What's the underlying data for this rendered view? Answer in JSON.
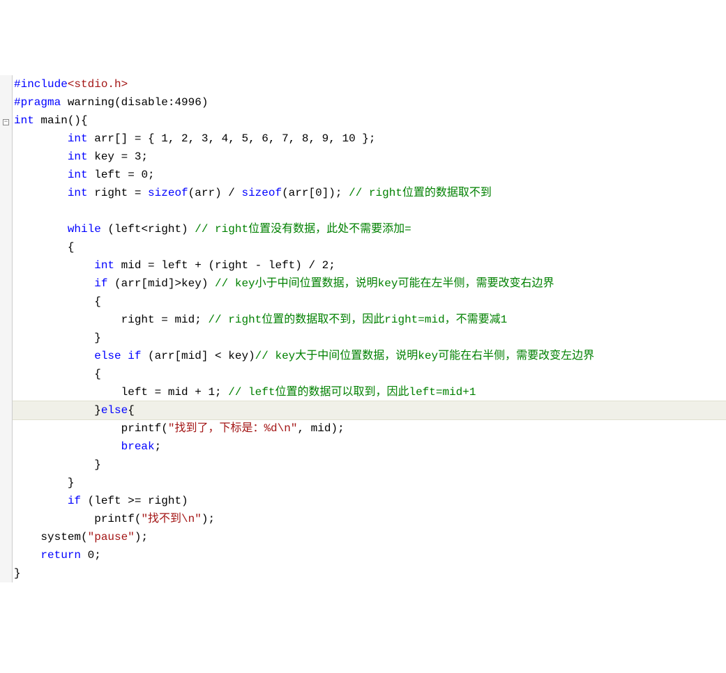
{
  "code": {
    "lines": [
      {
        "fold": "",
        "tokens": [
          {
            "cls": "preprocessor",
            "txt": "#include"
          },
          {
            "cls": "include-bracket",
            "txt": "<stdio.h>"
          }
        ]
      },
      {
        "fold": "",
        "tokens": [
          {
            "cls": "preprocessor",
            "txt": "#pragma"
          },
          {
            "cls": "identifier",
            "txt": " warning(disable:4996)"
          }
        ]
      },
      {
        "fold": "minus",
        "tokens": [
          {
            "cls": "typekw",
            "txt": "int"
          },
          {
            "cls": "identifier",
            "txt": " main(){"
          }
        ]
      },
      {
        "fold": "",
        "tokens": [
          {
            "cls": "identifier",
            "txt": "        "
          },
          {
            "cls": "typekw",
            "txt": "int"
          },
          {
            "cls": "identifier",
            "txt": " arr[] = { 1, 2, 3, 4, 5, 6, 7, 8, 9, 10 };"
          }
        ]
      },
      {
        "fold": "",
        "tokens": [
          {
            "cls": "identifier",
            "txt": "        "
          },
          {
            "cls": "typekw",
            "txt": "int"
          },
          {
            "cls": "identifier",
            "txt": " key = 3;"
          }
        ]
      },
      {
        "fold": "",
        "tokens": [
          {
            "cls": "identifier",
            "txt": "        "
          },
          {
            "cls": "typekw",
            "txt": "int"
          },
          {
            "cls": "identifier",
            "txt": " left = 0;"
          }
        ]
      },
      {
        "fold": "",
        "tokens": [
          {
            "cls": "identifier",
            "txt": "        "
          },
          {
            "cls": "typekw",
            "txt": "int"
          },
          {
            "cls": "identifier",
            "txt": " right = "
          },
          {
            "cls": "sizeof-kw",
            "txt": "sizeof"
          },
          {
            "cls": "identifier",
            "txt": "(arr) / "
          },
          {
            "cls": "sizeof-kw",
            "txt": "sizeof"
          },
          {
            "cls": "identifier",
            "txt": "(arr[0]); "
          },
          {
            "cls": "comment",
            "txt": "// right位置的数据取不到"
          }
        ]
      },
      {
        "fold": "",
        "tokens": [
          {
            "cls": "identifier",
            "txt": " "
          }
        ]
      },
      {
        "fold": "",
        "tokens": [
          {
            "cls": "identifier",
            "txt": "        "
          },
          {
            "cls": "keyword",
            "txt": "while"
          },
          {
            "cls": "identifier",
            "txt": " (left<right) "
          },
          {
            "cls": "comment",
            "txt": "// right位置没有数据，此处不需要添加="
          }
        ]
      },
      {
        "fold": "",
        "tokens": [
          {
            "cls": "identifier",
            "txt": "        {"
          }
        ]
      },
      {
        "fold": "",
        "tokens": [
          {
            "cls": "identifier",
            "txt": "            "
          },
          {
            "cls": "typekw",
            "txt": "int"
          },
          {
            "cls": "identifier",
            "txt": " mid = left + (right - left) / 2;"
          }
        ]
      },
      {
        "fold": "",
        "tokens": [
          {
            "cls": "identifier",
            "txt": "            "
          },
          {
            "cls": "keyword",
            "txt": "if"
          },
          {
            "cls": "identifier",
            "txt": " (arr[mid]>key) "
          },
          {
            "cls": "comment",
            "txt": "// key小于中间位置数据，说明key可能在左半侧，需要改变右边界"
          }
        ]
      },
      {
        "fold": "",
        "tokens": [
          {
            "cls": "identifier",
            "txt": "            {"
          }
        ]
      },
      {
        "fold": "",
        "tokens": [
          {
            "cls": "identifier",
            "txt": "                right = mid; "
          },
          {
            "cls": "comment",
            "txt": "// right位置的数据取不到，因此right=mid，不需要减1"
          }
        ]
      },
      {
        "fold": "",
        "tokens": [
          {
            "cls": "identifier",
            "txt": "            }"
          }
        ]
      },
      {
        "fold": "",
        "tokens": [
          {
            "cls": "identifier",
            "txt": "            "
          },
          {
            "cls": "keyword",
            "txt": "else"
          },
          {
            "cls": "identifier",
            "txt": " "
          },
          {
            "cls": "keyword",
            "txt": "if"
          },
          {
            "cls": "identifier",
            "txt": " (arr[mid] < key)"
          },
          {
            "cls": "comment",
            "txt": "// key大于中间位置数据，说明key可能在右半侧，需要改变左边界"
          }
        ]
      },
      {
        "fold": "",
        "tokens": [
          {
            "cls": "identifier",
            "txt": "            {"
          }
        ]
      },
      {
        "fold": "",
        "tokens": [
          {
            "cls": "identifier",
            "txt": "                left = mid + 1; "
          },
          {
            "cls": "comment",
            "txt": "// left位置的数据可以取到，因此left=mid+1"
          }
        ]
      },
      {
        "fold": "",
        "highlight": true,
        "tokens": [
          {
            "cls": "identifier",
            "txt": "            }"
          },
          {
            "cls": "keyword",
            "txt": "else"
          },
          {
            "cls": "identifier",
            "txt": "{"
          }
        ]
      },
      {
        "fold": "",
        "tokens": [
          {
            "cls": "identifier",
            "txt": "                printf("
          },
          {
            "cls": "string",
            "txt": "\"找到了，下标是：%d\\n\""
          },
          {
            "cls": "identifier",
            "txt": ", mid);"
          }
        ]
      },
      {
        "fold": "",
        "tokens": [
          {
            "cls": "identifier",
            "txt": "                "
          },
          {
            "cls": "keyword",
            "txt": "break"
          },
          {
            "cls": "identifier",
            "txt": ";"
          }
        ]
      },
      {
        "fold": "",
        "tokens": [
          {
            "cls": "identifier",
            "txt": "            }"
          }
        ]
      },
      {
        "fold": "",
        "tokens": [
          {
            "cls": "identifier",
            "txt": "        }"
          }
        ]
      },
      {
        "fold": "",
        "tokens": [
          {
            "cls": "identifier",
            "txt": "        "
          },
          {
            "cls": "keyword",
            "txt": "if"
          },
          {
            "cls": "identifier",
            "txt": " (left >= right)"
          }
        ]
      },
      {
        "fold": "",
        "tokens": [
          {
            "cls": "identifier",
            "txt": "            printf("
          },
          {
            "cls": "string",
            "txt": "\"找不到\\n\""
          },
          {
            "cls": "identifier",
            "txt": ");"
          }
        ]
      },
      {
        "fold": "",
        "tokens": [
          {
            "cls": "identifier",
            "txt": "    system("
          },
          {
            "cls": "string",
            "txt": "\"pause\""
          },
          {
            "cls": "identifier",
            "txt": ");"
          }
        ]
      },
      {
        "fold": "",
        "tokens": [
          {
            "cls": "identifier",
            "txt": "    "
          },
          {
            "cls": "keyword",
            "txt": "return"
          },
          {
            "cls": "identifier",
            "txt": " 0;"
          }
        ]
      },
      {
        "fold": "",
        "tokens": [
          {
            "cls": "identifier",
            "txt": "}"
          }
        ]
      }
    ]
  }
}
